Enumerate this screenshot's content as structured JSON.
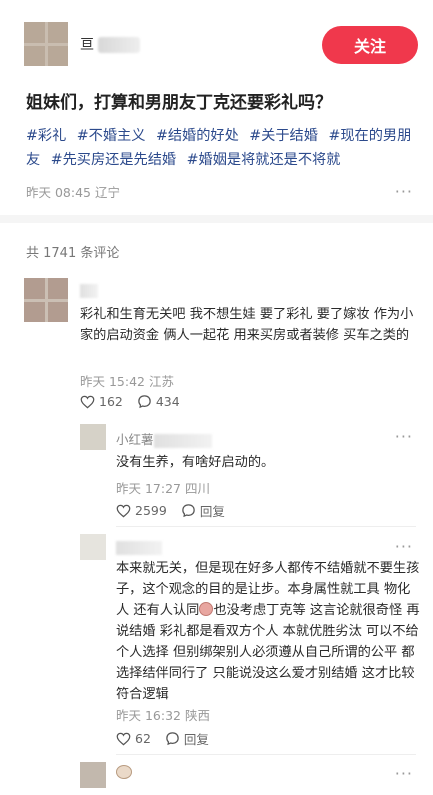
{
  "post": {
    "author_prefix": "亘",
    "follow_label": "关注",
    "title": "姐妹们，打算和男朋友丁克还要彩礼吗？",
    "tags": [
      "#彩礼",
      "#不婚主义",
      "#结婚的好处",
      "#关于结婚",
      "#现在的男朋友",
      "#先买房还是先结婚",
      "#婚姻是将就还是不将就"
    ],
    "time": "昨天 08:45",
    "location": "辽宁",
    "more": "···"
  },
  "comments_header": "共 1741 条评论",
  "comments": [
    {
      "text": "彩礼和生育无关吧 我不想生娃 要了彩礼 要了嫁妆 作为小家的启动资金 俩人一起花 用来买房或者装修 买车之类的",
      "time": "昨天 15:42",
      "location": "江苏",
      "likes": "162",
      "replies": "434"
    }
  ],
  "replies": [
    {
      "name_prefix": "小红薯",
      "text": "没有生养，有啥好启动的。",
      "time": "昨天 17:27",
      "location": "四川",
      "likes": "2599",
      "reply_label": "回复"
    },
    {
      "text_part1": "本来就无关，但是现在好多人都传不结婚就不要生孩子，这个观念的目的是让步。本身属性就工具 物化人 还有人认同",
      "text_part2": "也没考虑丁克等 这言论就很奇怪 再说结婚 彩礼都是看双方个人 本就优胜劣汰 可以不给 个人选择 但别绑架别人必须遵从自己所谓的公平 都选择结伴同行了 只能说没这么爱才别结婚 这才比较符合逻辑",
      "time": "昨天 16:32",
      "location": "陕西",
      "likes": "62",
      "reply_label": "回复"
    }
  ]
}
